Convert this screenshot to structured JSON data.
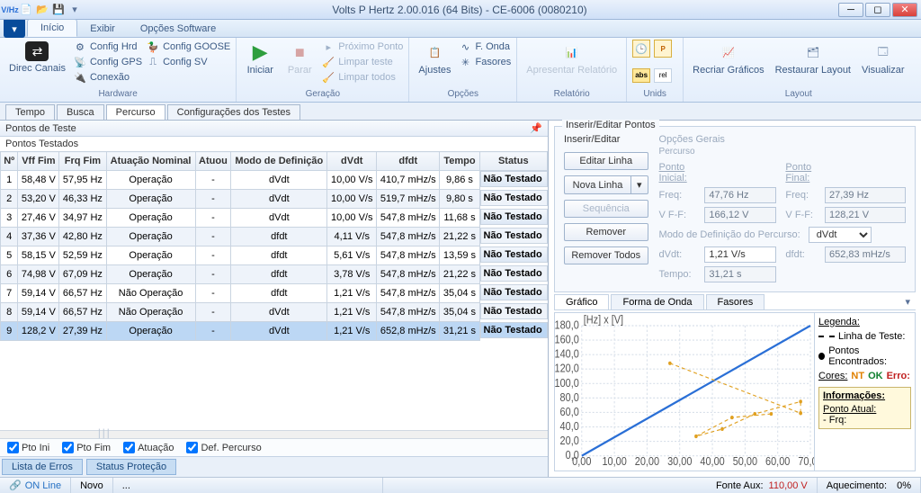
{
  "app": {
    "title": "Volts P Hertz 2.00.016 (64 Bits) - CE-6006 (0080210)",
    "qat_icons": [
      "vhz-icon",
      "new-icon",
      "open-icon",
      "save-icon"
    ]
  },
  "menu": {
    "tabs": [
      "Início",
      "Exibir",
      "Opções Software"
    ],
    "active": 0
  },
  "ribbon": {
    "groups": [
      {
        "label": "Hardware",
        "big": {
          "label": "Direc Canais",
          "icon": "channels-icon"
        },
        "list": [
          {
            "icon": "cfg",
            "label": "Config Hrd"
          },
          {
            "icon": "goose",
            "label": "Config GOOSE"
          },
          {
            "icon": "gps",
            "label": "Config GPS"
          },
          {
            "icon": "sv",
            "label": "Config SV"
          },
          {
            "icon": "conn",
            "label": "Conexão"
          }
        ]
      },
      {
        "label": "Geração",
        "bigs": [
          {
            "label": "Iniciar",
            "icon": "play-icon",
            "color": "#2e9e3e"
          },
          {
            "label": "Parar",
            "icon": "stop-icon",
            "color": "#c02020",
            "dis": true
          }
        ],
        "list": [
          {
            "label": "Próximo Ponto",
            "dis": true
          },
          {
            "label": "Limpar teste",
            "dis": true
          },
          {
            "label": "Limpar todos",
            "dis": true
          }
        ]
      },
      {
        "label": "Opções",
        "big": {
          "label": "Ajustes",
          "icon": "adjust-icon"
        },
        "list": [
          {
            "label": "F. Onda",
            "icon": "wave"
          },
          {
            "label": "Fasores",
            "icon": "phasor"
          }
        ]
      },
      {
        "label": "Relatório",
        "big": {
          "label": "Apresentar Relatório",
          "icon": "report-icon",
          "dis": true
        }
      },
      {
        "label": "Unids",
        "icons": [
          "clock",
          "pq",
          "abs",
          "rel"
        ]
      },
      {
        "label": "Layout",
        "bigs": [
          {
            "label": "Recriar Gráficos",
            "icon": "recreate-icon"
          },
          {
            "label": "Restaurar Layout",
            "icon": "restore-icon"
          },
          {
            "label": "Visualizar",
            "icon": "view-icon"
          }
        ]
      }
    ]
  },
  "sectabs": {
    "items": [
      "Tempo",
      "Busca",
      "Percurso",
      "Configurações dos Testes"
    ],
    "active": 2
  },
  "leftpanel": {
    "title": "Pontos de Teste",
    "subtitle": "Pontos Testados"
  },
  "table": {
    "headers": [
      "Nº",
      "Vff Fim",
      "Frq Fim",
      "Atuação Nominal",
      "Atuou",
      "Modo de Definição",
      "dVdt",
      "dfdt",
      "Tempo",
      "Status"
    ],
    "rows": [
      [
        "1",
        "58,48 V",
        "57,95 Hz",
        "Operação",
        "-",
        "dVdt",
        "10,00 V/s",
        "410,7 mHz/s",
        "9,86 s",
        "Não Testado"
      ],
      [
        "2",
        "53,20 V",
        "46,33 Hz",
        "Operação",
        "-",
        "dVdt",
        "10,00 V/s",
        "519,7 mHz/s",
        "9,80 s",
        "Não Testado"
      ],
      [
        "3",
        "27,46 V",
        "34,97 Hz",
        "Operação",
        "-",
        "dVdt",
        "10,00 V/s",
        "547,8 mHz/s",
        "11,68 s",
        "Não Testado"
      ],
      [
        "4",
        "37,36 V",
        "42,80 Hz",
        "Operação",
        "-",
        "dfdt",
        "4,11 V/s",
        "547,8 mHz/s",
        "21,22 s",
        "Não Testado"
      ],
      [
        "5",
        "58,15 V",
        "52,59 Hz",
        "Operação",
        "-",
        "dfdt",
        "5,61 V/s",
        "547,8 mHz/s",
        "13,59 s",
        "Não Testado"
      ],
      [
        "6",
        "74,98 V",
        "67,09 Hz",
        "Operação",
        "-",
        "dfdt",
        "3,78 V/s",
        "547,8 mHz/s",
        "21,22 s",
        "Não Testado"
      ],
      [
        "7",
        "59,14 V",
        "66,57 Hz",
        "Não Operação",
        "-",
        "dfdt",
        "1,21 V/s",
        "547,8 mHz/s",
        "35,04 s",
        "Não Testado"
      ],
      [
        "8",
        "59,14 V",
        "66,57 Hz",
        "Não Operação",
        "-",
        "dVdt",
        "1,21 V/s",
        "547,8 mHz/s",
        "35,04 s",
        "Não Testado"
      ],
      [
        "9",
        "128,2 V",
        "27,39 Hz",
        "Operação",
        "-",
        "dVdt",
        "1,21 V/s",
        "652,8 mHz/s",
        "31,21 s",
        "Não Testado"
      ]
    ],
    "selected": 8
  },
  "checks": [
    "Pto Ini",
    "Pto Fim",
    "Atuação",
    "Def. Percurso"
  ],
  "bottomtabs": [
    "Lista de Erros",
    "Status Proteção"
  ],
  "iep": {
    "title": "Inserir/Editar Pontos",
    "sub1": "Inserir/Editar",
    "sub2": "Opções Gerais",
    "sub3": "Percurso",
    "buttons": {
      "edit": "Editar Linha",
      "newline": "Nova Linha",
      "seq": "Sequência",
      "remove": "Remover",
      "removeall": "Remover Todos"
    },
    "labels": {
      "pi": "Ponto Inicial:",
      "pf": "Ponto Final:",
      "freq": "Freq:",
      "vff": "V F-F:",
      "mode": "Modo de Definição do Percurso:",
      "dvdt": "dVdt:",
      "dfdt": "dfdt:",
      "tempo": "Tempo:"
    },
    "values": {
      "fi": "47,76 Hz",
      "ff": "27,39 Hz",
      "vi": "166,12 V",
      "vf": "128,21 V",
      "mode": "dVdt",
      "dvdt": "1,21 V/s",
      "dfdt": "652,83 mHz/s",
      "tempo": "31,21 s"
    }
  },
  "graphtabs": {
    "items": [
      "Gráfico",
      "Forma de Onda",
      "Fasores"
    ],
    "active": 0
  },
  "legend": {
    "title": "Legenda:",
    "line": "Linha de Teste:",
    "points": "Pontos Encontrados:",
    "cores": "Cores:",
    "nt": "NT",
    "ok": "OK",
    "err": "Erro:",
    "info": "Informações:",
    "pa": "Ponto Atual:",
    "frq": "- Frq:"
  },
  "chart_data": {
    "type": "line",
    "title": "[Hz] x [V]",
    "xlim": [
      0,
      70
    ],
    "ylim": [
      0,
      180
    ],
    "xticks": [
      0,
      10,
      20,
      30,
      40,
      50,
      60,
      70
    ],
    "yticks": [
      0,
      20,
      40,
      60,
      80,
      100,
      120,
      140,
      160,
      180
    ],
    "series": [
      {
        "name": "blue-trend",
        "color": "#2a6fd6",
        "x": [
          0,
          70
        ],
        "y": [
          0,
          180
        ]
      },
      {
        "name": "orange-path",
        "color": "#e0a020",
        "dash": true,
        "x": [
          58,
          46,
          35,
          43,
          53,
          67,
          67,
          67,
          27
        ],
        "y": [
          58,
          53,
          27,
          37,
          58,
          75,
          59,
          59,
          128
        ]
      }
    ]
  },
  "status": {
    "online": "ON Line",
    "novo": "Novo",
    "dots": "...",
    "fonte": "Fonte Aux:",
    "fonteV": "110,00 V",
    "aq": "Aquecimento:",
    "aqV": "0%"
  }
}
